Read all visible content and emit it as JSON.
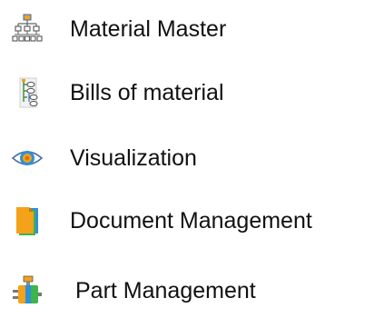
{
  "menu": {
    "items": [
      {
        "label": "Material Master",
        "icon": "hierarchy-icon"
      },
      {
        "label": "Bills of material",
        "icon": "bom-tree-icon"
      },
      {
        "label": "Visualization",
        "icon": "eye-icon"
      },
      {
        "label": "Document Management",
        "icon": "document-stack-icon"
      },
      {
        "label": "Part Management",
        "icon": "engine-part-icon"
      }
    ]
  }
}
